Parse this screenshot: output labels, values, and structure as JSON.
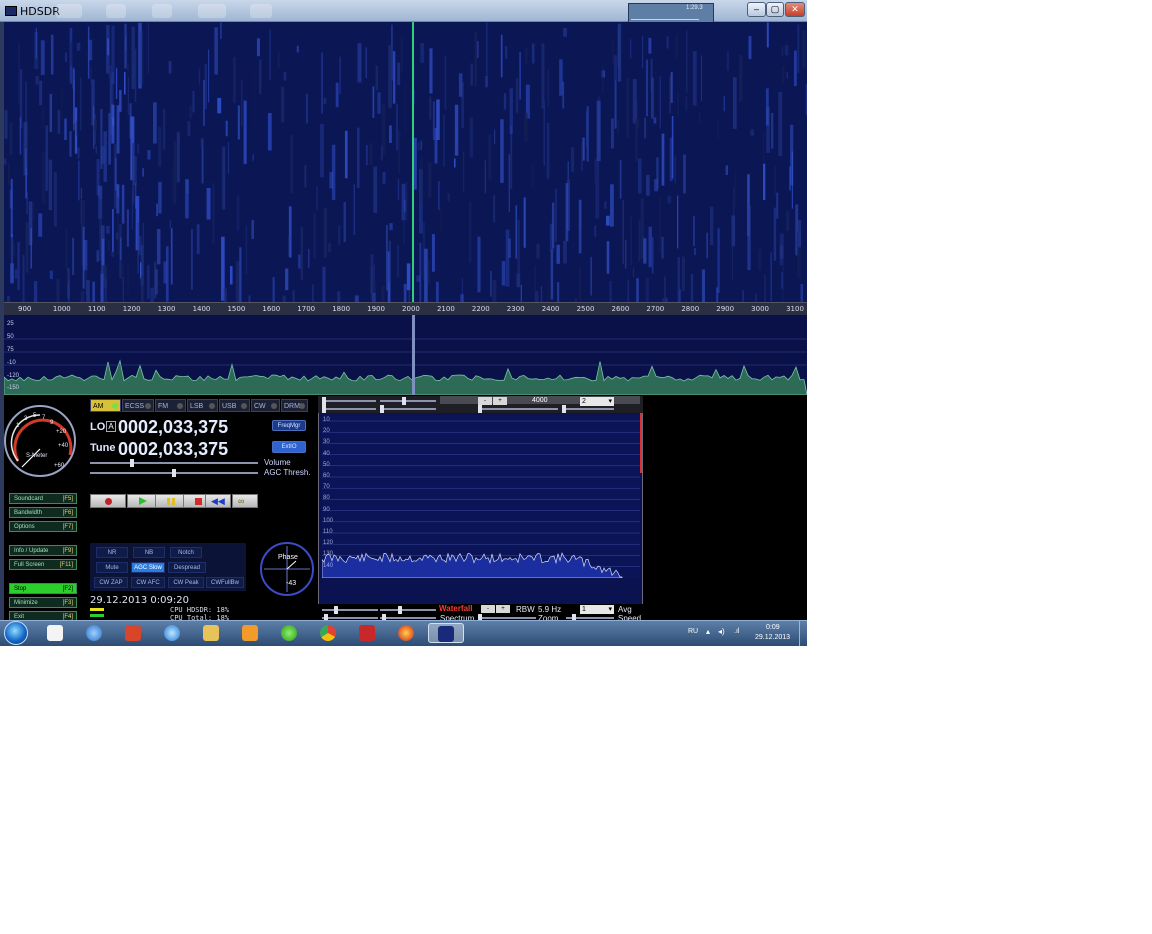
{
  "window": {
    "title": "HDSDR"
  },
  "minimap": {
    "text": "1:29.3"
  },
  "window_controls": {
    "minimize": "–",
    "maximize": "▢",
    "close": "✕"
  },
  "frequency_scale": {
    "labels": [
      "900",
      "1000",
      "1100",
      "1200",
      "1300",
      "1400",
      "1500",
      "1600",
      "1700",
      "1800",
      "1900",
      "2000",
      "2100",
      "2200",
      "2300",
      "2400",
      "2500",
      "2600",
      "2700",
      "2800",
      "2900",
      "3000",
      "3100"
    ]
  },
  "spectrum": {
    "db_labels": [
      "25",
      "50",
      "75",
      "-10",
      "-120",
      "-150"
    ]
  },
  "smeter": {
    "label": "S-Meter",
    "scale": [
      "1",
      "3",
      "5",
      "7",
      "9",
      "+20",
      "+40",
      "+60"
    ]
  },
  "modes": [
    {
      "label": "AM",
      "active": true
    },
    {
      "label": "ECSS",
      "active": false
    },
    {
      "label": "FM",
      "active": false
    },
    {
      "label": "LSB",
      "active": false
    },
    {
      "label": "USB",
      "active": false
    },
    {
      "label": "CW",
      "active": false
    },
    {
      "label": "DRM",
      "active": false
    }
  ],
  "lo": {
    "label": "LO",
    "badge": "A",
    "value": "0002,033,375"
  },
  "tune": {
    "label": "Tune",
    "value": "0002,033,375"
  },
  "freqmgr_label": "FreqMgr",
  "extio_label": "ExtIO",
  "sliders": {
    "volume_label": "Volume",
    "agc_label": "AGC Thresh."
  },
  "function_buttons": [
    {
      "label": "Soundcard",
      "key": "[F5]"
    },
    {
      "label": "Bandwidth",
      "key": "[F6]"
    },
    {
      "label": "Options",
      "key": "[F7]"
    },
    {
      "label": "Info / Update",
      "key": "[F9]"
    },
    {
      "label": "Full Screen",
      "key": "[F11]"
    },
    {
      "label": "Stop",
      "key": "[F2]"
    },
    {
      "label": "Minimize",
      "key": "[F3]"
    },
    {
      "label": "Exit",
      "key": "[F4]"
    }
  ],
  "dsp": {
    "row1": [
      "NR",
      "NB",
      "Notch"
    ],
    "row2": [
      "Mute",
      "AGC Slow",
      "Despread"
    ],
    "row3": [
      "CW ZAP",
      "CW AFC",
      "CW Peak",
      "CWFullBw"
    ],
    "active": "AGC Slow"
  },
  "clock": "29.12.2013 0:09:20",
  "cpu": {
    "hdsdr": "CPU HDSDR: 18%",
    "total": "CPU Total: 18%"
  },
  "phase": {
    "label": "Phase",
    "value": "-43"
  },
  "scope": {
    "top_value": "4000",
    "top_select": "2",
    "y_labels": [
      "10",
      "20",
      "30",
      "40",
      "50",
      "60",
      "70",
      "80",
      "90",
      "100",
      "110",
      "120",
      "130",
      "140"
    ],
    "waterfall_label": "Waterfall",
    "rbw_label": "RBW",
    "rbw_value": "5.9 Hz",
    "avg_select": "1",
    "avg_label": "Avg",
    "spectrum_label": "Spectrum",
    "zoom_label": "Zoom",
    "speed_label": "Speed"
  },
  "tray": {
    "lang": "RU",
    "time": "0:09",
    "date": "29.12.2013"
  },
  "colors": {
    "waterfall_bg": "#0b1655",
    "marker": "#2ecf7a",
    "accent": "#2a7de0",
    "waterfall_text": "#ff3b30"
  }
}
